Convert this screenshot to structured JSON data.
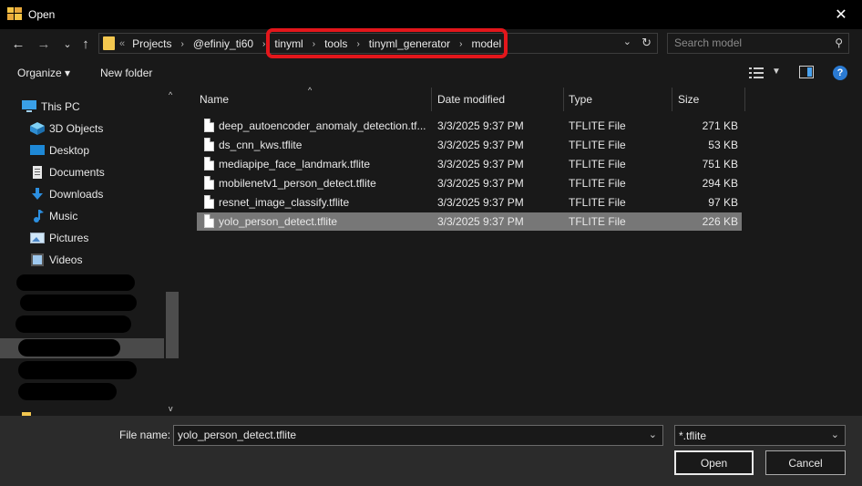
{
  "window": {
    "title": "Open",
    "close_glyph": "✕"
  },
  "nav": {
    "back_glyph": "←",
    "forward_glyph": "→",
    "recent_glyph": "⌄",
    "up_glyph": "↑",
    "overflow": "«",
    "breadcrumbs": [
      "Projects",
      "@efiniy_ti60",
      "tinyml",
      "tools",
      "tinyml_generator",
      "model"
    ],
    "separator": "›",
    "search_placeholder": "Search model"
  },
  "toolbar": {
    "organize_label": "Organize ▾",
    "new_folder_label": "New folder",
    "help_glyph": "?"
  },
  "sidebar": {
    "items": [
      {
        "label": "This PC",
        "icon": "pc-icon"
      },
      {
        "label": "3D Objects",
        "icon": "cube-icon"
      },
      {
        "label": "Desktop",
        "icon": "desktop-icon"
      },
      {
        "label": "Documents",
        "icon": "documents-icon"
      },
      {
        "label": "Downloads",
        "icon": "download-icon"
      },
      {
        "label": "Music",
        "icon": "music-icon"
      },
      {
        "label": "Pictures",
        "icon": "pictures-icon"
      },
      {
        "label": "Videos",
        "icon": "videos-icon"
      }
    ]
  },
  "columns": {
    "name": "Name",
    "date": "Date modified",
    "type": "Type",
    "size": "Size"
  },
  "files": [
    {
      "name": "deep_autoencoder_anomaly_detection.tf...",
      "date": "3/3/2025 9:37 PM",
      "type": "TFLITE File",
      "size": "271 KB"
    },
    {
      "name": "ds_cnn_kws.tflite",
      "date": "3/3/2025 9:37 PM",
      "type": "TFLITE File",
      "size": "53 KB"
    },
    {
      "name": "mediapipe_face_landmark.tflite",
      "date": "3/3/2025 9:37 PM",
      "type": "TFLITE File",
      "size": "751 KB"
    },
    {
      "name": "mobilenetv1_person_detect.tflite",
      "date": "3/3/2025 9:37 PM",
      "type": "TFLITE File",
      "size": "294 KB"
    },
    {
      "name": "resnet_image_classify.tflite",
      "date": "3/3/2025 9:37 PM",
      "type": "TFLITE File",
      "size": "97 KB"
    },
    {
      "name": "yolo_person_detect.tflite",
      "date": "3/3/2025 9:37 PM",
      "type": "TFLITE File",
      "size": "226 KB"
    }
  ],
  "footer": {
    "file_name_label": "File name:",
    "file_name_value": "yolo_person_detect.tflite",
    "filter_value": "*.tflite",
    "open_label": "Open",
    "cancel_label": "Cancel"
  },
  "colors": {
    "annotation_outline": "#e3161b",
    "selection": "#777777",
    "background": "#191919"
  }
}
